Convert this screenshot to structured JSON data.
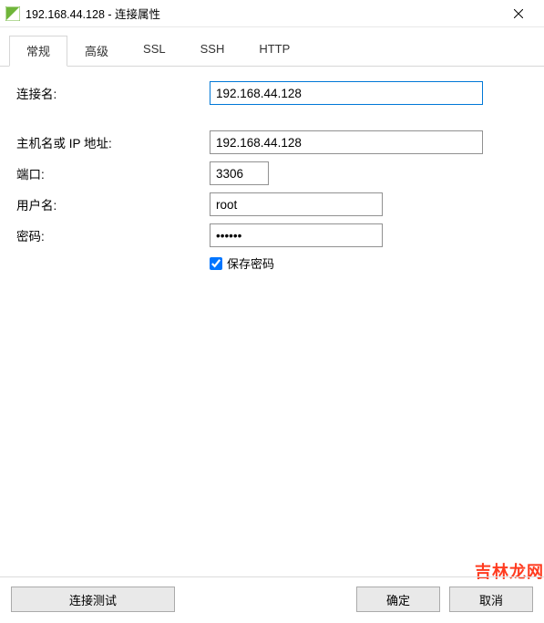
{
  "window": {
    "title": "192.168.44.128 - 连接属性"
  },
  "tabs": {
    "general": "常规",
    "advanced": "高级",
    "ssl": "SSL",
    "ssh": "SSH",
    "http": "HTTP"
  },
  "form": {
    "conn_name_label": "连接名:",
    "conn_name_value": "192.168.44.128",
    "host_label": "主机名或 IP 地址:",
    "host_value": "192.168.44.128",
    "port_label": "端口:",
    "port_value": "3306",
    "user_label": "用户名:",
    "user_value": "root",
    "pass_label": "密码:",
    "pass_value": "••••••",
    "save_pass_label": "保存密码",
    "save_pass_checked": true
  },
  "buttons": {
    "test": "连接测试",
    "ok": "确定",
    "cancel": "取消"
  },
  "watermark": "吉林龙网"
}
